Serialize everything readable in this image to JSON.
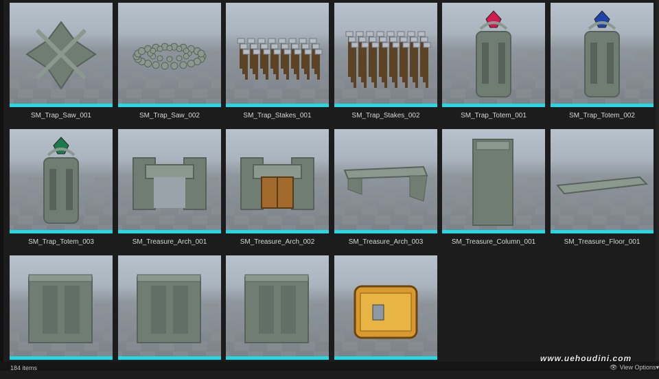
{
  "assets": [
    {
      "name": "SM_Trap_Saw_001",
      "icon": "trap-saw-mesh"
    },
    {
      "name": "SM_Trap_Saw_002",
      "icon": "trap-saw-mesh"
    },
    {
      "name": "SM_Trap_Stakes_001",
      "icon": "trap-stakes-mesh"
    },
    {
      "name": "SM_Trap_Stakes_002",
      "icon": "trap-stakes-mesh"
    },
    {
      "name": "SM_Trap_Totem_001",
      "icon": "trap-totem-mesh",
      "gem_color": "#d21a4e"
    },
    {
      "name": "SM_Trap_Totem_002",
      "icon": "trap-totem-mesh",
      "gem_color": "#1f43a8"
    },
    {
      "name": "SM_Trap_Totem_003",
      "icon": "trap-totem-mesh",
      "gem_color": "#1c7a4c"
    },
    {
      "name": "SM_Treasure_Arch_001",
      "icon": "arch-mesh"
    },
    {
      "name": "SM_Treasure_Arch_002",
      "icon": "arch-door-mesh"
    },
    {
      "name": "SM_Treasure_Arch_003",
      "icon": "bench-arch-mesh"
    },
    {
      "name": "SM_Treasure_Column_001",
      "icon": "column-mesh"
    },
    {
      "name": "SM_Treasure_Floor_001",
      "icon": "floor-mesh"
    },
    {
      "name": "",
      "icon": "wall-mesh"
    },
    {
      "name": "",
      "icon": "wall-mesh"
    },
    {
      "name": "",
      "icon": "wall-mesh"
    },
    {
      "name": "",
      "icon": "treasure-chest-mesh"
    }
  ],
  "status": {
    "item_count": "184 items",
    "view_options": "View Options"
  },
  "watermark": "www.uehoudini.com",
  "colors": {
    "accent_bar": "#22d9e6",
    "stone": "#6f7d72",
    "background": "#1c1c1c"
  }
}
